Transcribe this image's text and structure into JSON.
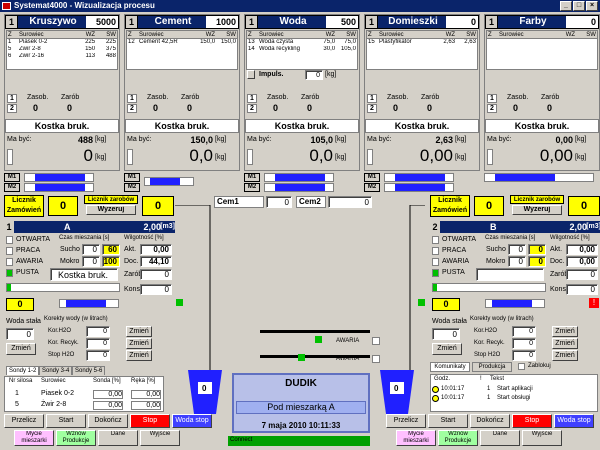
{
  "window": {
    "title": "Systemat4000 - Wizualizacja procesu"
  },
  "units": {
    "kg": "[kg]",
    "m3": "[m3]"
  },
  "colors": {
    "title_bg": "#0a246a",
    "accent_yellow": "#ffff00",
    "blue": "#2020ff",
    "green": "#00c000",
    "red": "#ff0000"
  },
  "silos": [
    {
      "num": "1",
      "name": "Kruszywo",
      "value": "5000",
      "cols": [
        "Z",
        "Surowiec",
        "WZ",
        "SW"
      ],
      "rows": [
        [
          "1",
          "Piasek 0-2",
          "225",
          "225"
        ],
        [
          "5",
          "Żwir 2-8",
          "150",
          "375"
        ],
        [
          "6",
          "Żwir 2-16",
          "113",
          "488"
        ]
      ],
      "zasob_label": "Zasob.",
      "zarob_label": "Zarób",
      "z1": "1",
      "z2": "2",
      "zasob": "0",
      "zarob": "0",
      "recipe": "Kostka bruk.",
      "ma_byc_label": "Ma być:",
      "ma_byc": "488",
      "weight": "0"
    },
    {
      "num": "1",
      "name": "Cement",
      "value": "1000",
      "cols": [
        "Z",
        "Surowiec",
        "WZ",
        "SW"
      ],
      "rows": [
        [
          "12",
          "Cement 42,5R",
          "150,0",
          "150,0"
        ]
      ],
      "zasob_label": "Zasob.",
      "zarob_label": "Zarób",
      "z1": "1",
      "z2": "2",
      "zasob": "0",
      "zarob": "0",
      "recipe": "Kostka bruk.",
      "ma_byc_label": "Ma być:",
      "ma_byc": "150,0",
      "weight": "0,0"
    },
    {
      "num": "1",
      "name": "Woda",
      "value": "500",
      "cols": [
        "Z",
        "Surowiec",
        "WZ",
        "SW"
      ],
      "rows": [
        [
          "13",
          "Woda czysta",
          "75,0",
          "75,0"
        ],
        [
          "14",
          "Woda recykling",
          "30,0",
          "105,0"
        ]
      ],
      "impuls_label": "Impuls.",
      "impuls": "0",
      "zasob_label": "Zasob.",
      "zarob_label": "Zarób",
      "z1": "1",
      "z2": "2",
      "zasob": "0",
      "zarob": "0",
      "recipe": "Kostka bruk.",
      "ma_byc_label": "Ma być:",
      "ma_byc": "105,0",
      "weight": "0,0"
    },
    {
      "num": "1",
      "name": "Domieszki",
      "value": "0",
      "cols": [
        "Z",
        "Surowiec",
        "WZ",
        "SW"
      ],
      "rows": [
        [
          "15",
          "Plastyfikator",
          "2,63",
          "2,63"
        ]
      ],
      "zasob_label": "Zasob.",
      "zarob_label": "Zarób",
      "z1": "1",
      "z2": "2",
      "zasob": "0",
      "zarob": "0",
      "recipe": "Kostka bruk.",
      "ma_byc_label": "Ma być:",
      "ma_byc": "2,63",
      "weight": "0,00"
    },
    {
      "num": "1",
      "name": "Farby",
      "value": "0",
      "cols": [
        "Z",
        "Surowiec",
        "WZ",
        "SW"
      ],
      "rows": [],
      "zasob_label": "Zasob.",
      "zarob_label": "Zarób",
      "z1": "1",
      "z2": "2",
      "zasob": "0",
      "zarob": "0",
      "recipe": "Kostka bruk.",
      "ma_byc_label": "Ma być:",
      "ma_byc": "0,00",
      "weight": "0,00"
    }
  ],
  "motors": {
    "m1": "M1",
    "m2": "M2"
  },
  "counters": {
    "orders_label": "Licznik Zamówień",
    "orders_value": "0",
    "batches_label": "Licznik zarobów",
    "reset": "Wyzeruj",
    "batches_value": "0"
  },
  "cem": {
    "cem1_label": "Cem1",
    "cem1": "0",
    "cem2_label": "Cem2",
    "cem2": "0"
  },
  "mixerA": {
    "num": "1",
    "name": "A",
    "volume": "2,00",
    "states": [
      "OTWARTA",
      "PRACA",
      "AWARIA",
      "PUSTA"
    ],
    "czas_label": "Czas mieszania [s]",
    "wilg_label": "Wilgotność [%]",
    "sucho_label": "Sucho",
    "sucho_a": "0",
    "sucho_b": "60",
    "mokro_label": "Mokro",
    "mokro_a": "0",
    "mokro_b": "100",
    "akt_label": "Akt.",
    "akt": "0,00",
    "doc_label": "Doc.",
    "doc": "44,10",
    "recipe": "Kostka bruk.",
    "zarob_label": "Zarób",
    "zarob": "0",
    "kons_label": "Kons.",
    "kons": "0",
    "yellow": "0",
    "water_title": "Woda stała",
    "water": "0",
    "korekty_title": "Korekty wody (w litrach)",
    "kor_h2o": "Kor.H2O",
    "kor_recyk": "Kor. Recyk.",
    "stop_h2o": "Stop H2O",
    "zmien": "Zmień",
    "v1": "0",
    "v2": "0",
    "v3": "0"
  },
  "mixerB": {
    "num": "2",
    "name": "B",
    "volume": "2,00",
    "states": [
      "OTWARTA",
      "PRACA",
      "AWARIA",
      "PUSTA"
    ],
    "czas_label": "Czas mieszania [s]",
    "wilg_label": "Wilgotność [%]",
    "sucho_label": "Sucho",
    "sucho_a": "0",
    "sucho_b": "0",
    "mokro_label": "Mokro",
    "mokro_a": "0",
    "mokro_b": "0",
    "akt_label": "Akt.",
    "akt": "0,00",
    "doc_label": "Doc.",
    "doc": "0,00",
    "recipe": "",
    "zarob_label": "Zarób",
    "zarob": "0",
    "kons_label": "Kons.",
    "kons": "0",
    "yellow": "0",
    "water_title": "Woda stała",
    "water": "0",
    "korekty_title": "Korekty wody (w litrach)",
    "kor_h2o": "Kor.H2O",
    "kor_recyk": "Kor. Recyk.",
    "stop_h2o": "Stop H2O",
    "zmien": "Zmień",
    "v1": "0",
    "v2": "0",
    "v3": "0"
  },
  "awaria": "AWARIA",
  "center": {
    "client": "DUDIK",
    "location": "Pod mieszarką A",
    "datetime": "7 maja 2010 10:11:33",
    "status": "Connect"
  },
  "sondy": {
    "tabs": [
      "Sondy 1-2",
      "Sondy 3-4",
      "Sondy 5-6"
    ],
    "cols": [
      "Nr silosa",
      "Surowiec",
      "Sonda [%]",
      "Ręka [%]"
    ],
    "rows": [
      [
        "1",
        "Piasek 0-2",
        "0,00",
        "0,00"
      ],
      [
        "5",
        "Żwir 2-8",
        "0,00",
        "0,00"
      ]
    ]
  },
  "messages": {
    "tabs": [
      "Komunikaty",
      "Produkcja"
    ],
    "lock": "Zablokuj",
    "cols": [
      "Godz.",
      "!",
      "Tekst"
    ],
    "rows": [
      [
        "10:01:17",
        "1",
        "Start aplikacji"
      ],
      [
        "10:01:17",
        "1",
        "Start obsługi"
      ]
    ]
  },
  "buttons_left": {
    "przelicz": "Przelicz",
    "start": "Start",
    "dokoncz": "Dokończ",
    "stop": "Stop",
    "wodastop": "Woda stop",
    "mycie": "Mycie mieszarki",
    "wznow": "Wznów Produkcje",
    "dane": "Dane",
    "wyjscie": "Wyjście"
  },
  "buttons_right": {
    "przelicz": "Przelicz",
    "start": "Start",
    "dokoncz": "Dokończ",
    "stop": "Stop",
    "wodastop": "Woda stop",
    "mycie": "Mycie mieszarki",
    "wznow": "Wznów Produkcje",
    "dane": "Dane",
    "wyjscie": "Wyjście"
  }
}
